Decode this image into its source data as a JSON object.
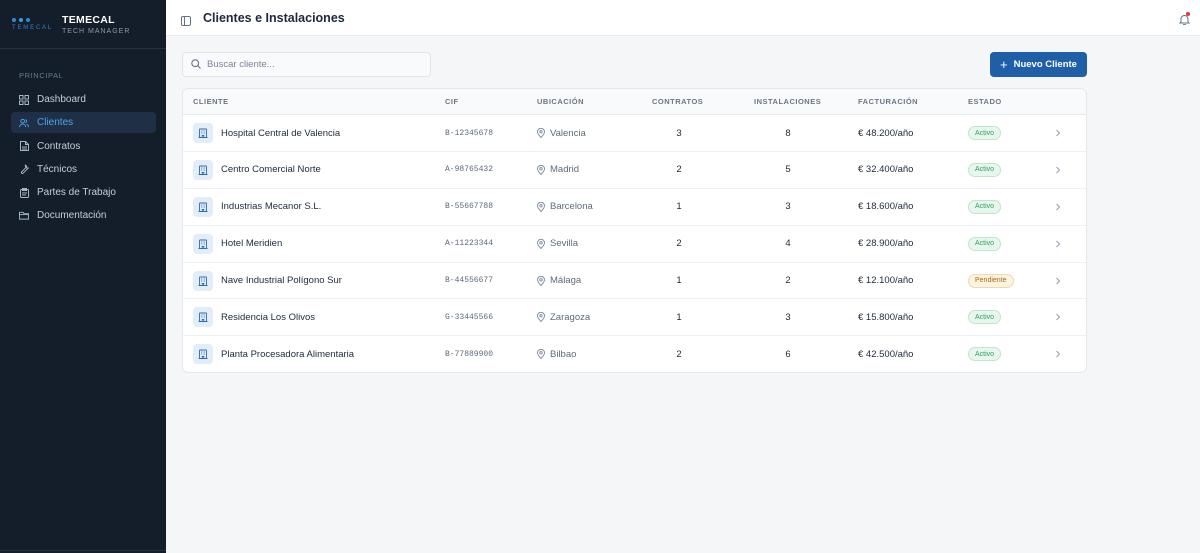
{
  "brand": {
    "logo_text": "TEMECAL",
    "title": "TEMECAL",
    "subtitle": "TECH MANAGER"
  },
  "sidebar": {
    "section_label": "PRINCIPAL",
    "items": [
      {
        "label": "Dashboard",
        "icon": "grid-icon",
        "active": false
      },
      {
        "label": "Clientes",
        "icon": "users-icon",
        "active": true
      },
      {
        "label": "Contratos",
        "icon": "file-icon",
        "active": false
      },
      {
        "label": "Técnicos",
        "icon": "wrench-icon",
        "active": false
      },
      {
        "label": "Partes de Trabajo",
        "icon": "clipboard-icon",
        "active": false
      },
      {
        "label": "Documentación",
        "icon": "folder-icon",
        "active": false
      }
    ]
  },
  "header": {
    "title": "Clientes e Instalaciones"
  },
  "search": {
    "placeholder": "Buscar cliente...",
    "value": ""
  },
  "actions": {
    "new_client_label": "Nuevo Cliente"
  },
  "table": {
    "columns": [
      "CLIENTE",
      "CIF",
      "UBICACIÓN",
      "CONTRATOS",
      "INSTALACIONES",
      "FACTURACIÓN",
      "ESTADO"
    ],
    "rows": [
      {
        "cliente": "Hospital Central de Valencia",
        "cif": "B-12345678",
        "ubicacion": "Valencia",
        "contratos": "3",
        "instalaciones": "8",
        "facturacion": "€ 48.200/año",
        "estado": "Activo"
      },
      {
        "cliente": "Centro Comercial Norte",
        "cif": "A-98765432",
        "ubicacion": "Madrid",
        "contratos": "2",
        "instalaciones": "5",
        "facturacion": "€ 32.400/año",
        "estado": "Activo"
      },
      {
        "cliente": "Industrias Mecanor S.L.",
        "cif": "B-55667788",
        "ubicacion": "Barcelona",
        "contratos": "1",
        "instalaciones": "3",
        "facturacion": "€ 18.600/año",
        "estado": "Activo"
      },
      {
        "cliente": "Hotel Meridien",
        "cif": "A-11223344",
        "ubicacion": "Sevilla",
        "contratos": "2",
        "instalaciones": "4",
        "facturacion": "€ 28.900/año",
        "estado": "Activo"
      },
      {
        "cliente": "Nave Industrial Polígono Sur",
        "cif": "B-44556677",
        "ubicacion": "Málaga",
        "contratos": "1",
        "instalaciones": "2",
        "facturacion": "€ 12.100/año",
        "estado": "Pendiente"
      },
      {
        "cliente": "Residencia Los Olivos",
        "cif": "G-33445566",
        "ubicacion": "Zaragoza",
        "contratos": "1",
        "instalaciones": "3",
        "facturacion": "€ 15.800/año",
        "estado": "Activo"
      },
      {
        "cliente": "Planta Procesadora Alimentaria",
        "cif": "B-77889900",
        "ubicacion": "Bilbao",
        "contratos": "2",
        "instalaciones": "6",
        "facturacion": "€ 42.500/año",
        "estado": "Activo"
      }
    ]
  },
  "colors": {
    "sidebar_bg": "#141e2b",
    "accent": "#1f5fa8",
    "active_text": "#4da3f0",
    "status_active": "#2e9e5b",
    "status_pending": "#a86a12",
    "notification_dot": "#e53935"
  }
}
